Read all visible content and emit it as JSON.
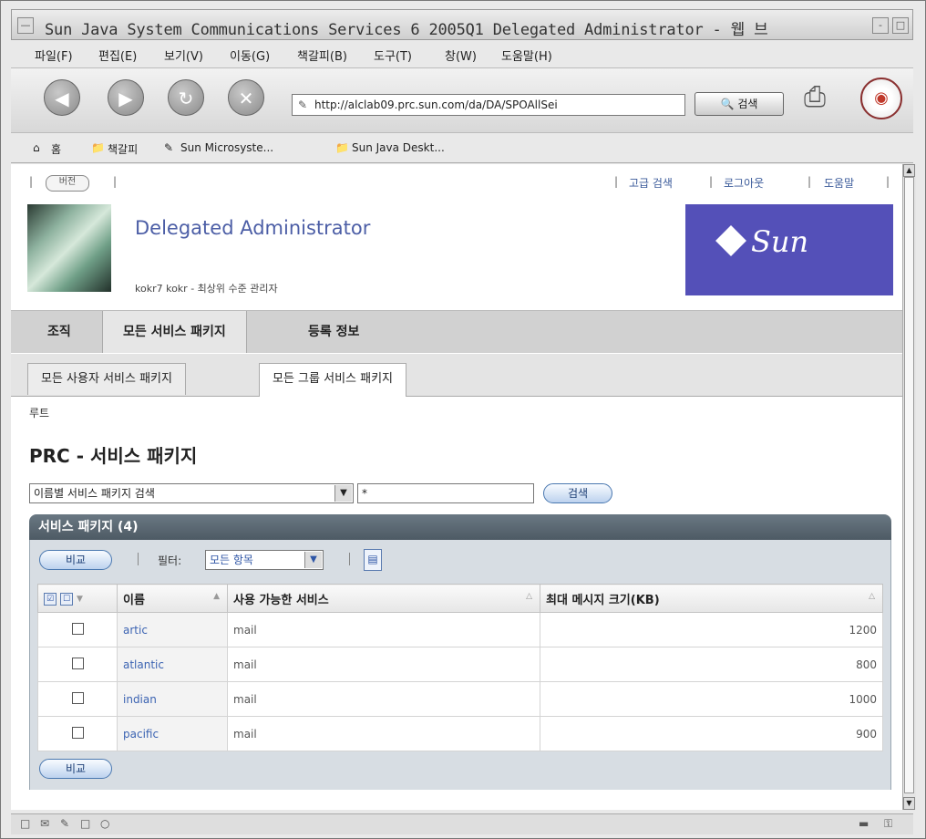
{
  "window": {
    "title": "Sun Java System Communications Services 6 2005Q1 Delegated Administrator - 웹 브"
  },
  "menu": [
    "파일(F)",
    "편집(E)",
    "보기(V)",
    "이동(G)",
    "책갈피(B)",
    "도구(T)",
    "창(W)",
    "도움말(H)"
  ],
  "toolbar": {
    "url": "http://alclab09.prc.sun.com/da/DA/SPOAllSei",
    "search_label": "검색"
  },
  "bookmarks": {
    "home": "홈",
    "items": [
      "책갈피",
      "Sun Microsyste...",
      "Sun Java Deskt..."
    ]
  },
  "header": {
    "version_label": "버전",
    "links": [
      "고급 검색",
      "로그아웃",
      "도움말"
    ],
    "app_name": "Delegated Administrator",
    "user_line": "kokr7 kokr - 최상위 수준 관리자"
  },
  "tabs": {
    "primary": [
      "조직",
      "모든 서비스 패키지",
      "등록 정보"
    ],
    "secondary": [
      "모든 사용자 서비스 패키지",
      "모든 그룹 서비스 패키지"
    ]
  },
  "breadcrumb": "루트",
  "page_title": "PRC - 서비스 패키지",
  "search": {
    "select_value": "이름별 서비스 패키지 검색",
    "input_value": "*",
    "button_label": "검색"
  },
  "table": {
    "title": "서비스 패키지 (4)",
    "compare_label": "비교",
    "filter_label": "필터:",
    "filter_value": "모든 항목",
    "columns": [
      "이름",
      "사용 가능한 서비스",
      "최대 메시지 크기(KB)"
    ],
    "rows": [
      {
        "name": "artic",
        "services": "mail",
        "size": "1200"
      },
      {
        "name": "atlantic",
        "services": "mail",
        "size": "800"
      },
      {
        "name": "indian",
        "services": "mail",
        "size": "1000"
      },
      {
        "name": "pacific",
        "services": "mail",
        "size": "900"
      }
    ],
    "bottom_compare_label": "비교"
  },
  "colors": {
    "accent": "#4c5ea6",
    "sun_logo_bg": "#5450b8",
    "table_header": "#5b6873"
  }
}
